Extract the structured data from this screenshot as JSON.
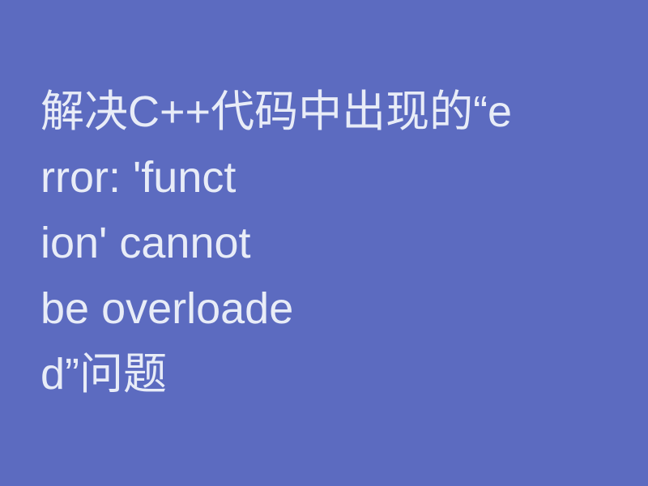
{
  "content": {
    "line1": "解决C++代码中出现的“e",
    "line2": "rror: 'funct",
    "line3": "ion' cannot",
    "line4": "be overloade",
    "line5": "d”问题"
  }
}
